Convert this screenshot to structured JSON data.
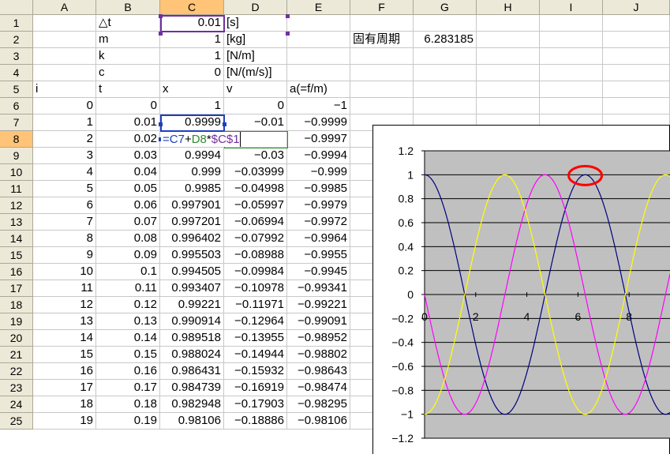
{
  "columns": [
    "A",
    "B",
    "C",
    "D",
    "E",
    "F",
    "G",
    "H",
    "I",
    "J"
  ],
  "selected_column": "C",
  "selected_row": "8",
  "rows": [
    {
      "n": "1",
      "cells": {
        "B": "△t",
        "C": "0.01",
        "D": "[s]"
      }
    },
    {
      "n": "2",
      "cells": {
        "B": "m",
        "C": "1",
        "D": "[kg]",
        "F": "固有周期",
        "G": "6.283185"
      }
    },
    {
      "n": "3",
      "cells": {
        "B": "k",
        "C": "1",
        "D": "[N/m]"
      }
    },
    {
      "n": "4",
      "cells": {
        "B": "c",
        "C": "0",
        "D": "[N/(m/s)]"
      }
    },
    {
      "n": "5",
      "cells": {
        "A": "i",
        "B": "t",
        "C": "x",
        "D": "v",
        "E": "a(=f/m)"
      }
    },
    {
      "n": "6",
      "cells": {
        "A": "0",
        "B": "0",
        "C": "1",
        "D": "0",
        "E": "-1"
      }
    },
    {
      "n": "7",
      "cells": {
        "A": "1",
        "B": "0.01",
        "C": "0.9999",
        "D": "-0.01",
        "E": "-0.9999"
      }
    },
    {
      "n": "8",
      "cells": {
        "A": "2",
        "B": "0.02",
        "E": "-0.9997"
      }
    },
    {
      "n": "9",
      "cells": {
        "A": "3",
        "B": "0.03",
        "C": "0.9994",
        "D": "-0.03",
        "E": "-0.9994"
      }
    },
    {
      "n": "10",
      "cells": {
        "A": "4",
        "B": "0.04",
        "C": "0.999",
        "D": "-0.03999",
        "E": "-0.999"
      }
    },
    {
      "n": "11",
      "cells": {
        "A": "5",
        "B": "0.05",
        "C": "0.9985",
        "D": "-0.04998",
        "E": "-0.9985"
      }
    },
    {
      "n": "12",
      "cells": {
        "A": "6",
        "B": "0.06",
        "C": "0.997901",
        "D": "-0.05997",
        "E": "-0.9979"
      }
    },
    {
      "n": "13",
      "cells": {
        "A": "7",
        "B": "0.07",
        "C": "0.997201",
        "D": "-0.06994",
        "E": "-0.9972"
      }
    },
    {
      "n": "14",
      "cells": {
        "A": "8",
        "B": "0.08",
        "C": "0.996402",
        "D": "-0.07992",
        "E": "-0.9964"
      }
    },
    {
      "n": "15",
      "cells": {
        "A": "9",
        "B": "0.09",
        "C": "0.995503",
        "D": "-0.08988",
        "E": "-0.9955"
      }
    },
    {
      "n": "16",
      "cells": {
        "A": "10",
        "B": "0.1",
        "C": "0.994505",
        "D": "-0.09984",
        "E": "-0.9945"
      }
    },
    {
      "n": "17",
      "cells": {
        "A": "11",
        "B": "0.11",
        "C": "0.993407",
        "D": "-0.10978",
        "E": "-0.99341"
      }
    },
    {
      "n": "18",
      "cells": {
        "A": "12",
        "B": "0.12",
        "C": "0.99221",
        "D": "-0.11971",
        "E": "-0.99221"
      }
    },
    {
      "n": "19",
      "cells": {
        "A": "13",
        "B": "0.13",
        "C": "0.990914",
        "D": "-0.12964",
        "E": "-0.99091"
      }
    },
    {
      "n": "20",
      "cells": {
        "A": "14",
        "B": "0.14",
        "C": "0.989518",
        "D": "-0.13955",
        "E": "-0.98952"
      }
    },
    {
      "n": "21",
      "cells": {
        "A": "15",
        "B": "0.15",
        "C": "0.988024",
        "D": "-0.14944",
        "E": "-0.98802"
      }
    },
    {
      "n": "22",
      "cells": {
        "A": "16",
        "B": "0.16",
        "C": "0.986431",
        "D": "-0.15932",
        "E": "-0.98643"
      }
    },
    {
      "n": "23",
      "cells": {
        "A": "17",
        "B": "0.17",
        "C": "0.984739",
        "D": "-0.16919",
        "E": "-0.98474"
      }
    },
    {
      "n": "24",
      "cells": {
        "A": "18",
        "B": "0.18",
        "C": "0.982948",
        "D": "-0.17903",
        "E": "-0.98295"
      }
    },
    {
      "n": "25",
      "cells": {
        "A": "19",
        "B": "0.19",
        "C": "0.98106",
        "D": "-0.18886",
        "E": "-0.98106"
      }
    }
  ],
  "formula_edit": {
    "cell": "C8",
    "parts": [
      {
        "text": "=",
        "color": "#1f3fbf"
      },
      {
        "text": "C7",
        "color": "#1f3fbf"
      },
      {
        "text": "+",
        "color": "#000000"
      },
      {
        "text": "D8",
        "color": "#2e8b2e"
      },
      {
        "text": "*",
        "color": "#000000"
      },
      {
        "text": "$C$1",
        "color": "#7030a0"
      }
    ]
  },
  "chart_data": {
    "type": "line",
    "ylim": [
      -1.2,
      1.2
    ],
    "xlim": [
      0,
      9.6
    ],
    "yticks": [
      "1.2",
      "1",
      "0.8",
      "0.6",
      "0.4",
      "0.2",
      "0",
      "-0.2",
      "-0.4",
      "-0.6",
      "-0.8",
      "-1",
      "-1.2"
    ],
    "xticks": [
      "0",
      "2",
      "4",
      "6",
      "8"
    ],
    "grid": true,
    "legend": "none",
    "plot_background": "#c0c0c0",
    "series": [
      {
        "function": "cos",
        "phase": 0,
        "color": "#000080"
      },
      {
        "function": "-sin",
        "phase": 0,
        "color": "#ff00ff"
      },
      {
        "function": "-cos",
        "phase": 0,
        "color": "#ffff00"
      }
    ],
    "annotation": {
      "type": "ellipse",
      "x": 6.283185,
      "y": 1,
      "color": "#ff0000"
    }
  }
}
